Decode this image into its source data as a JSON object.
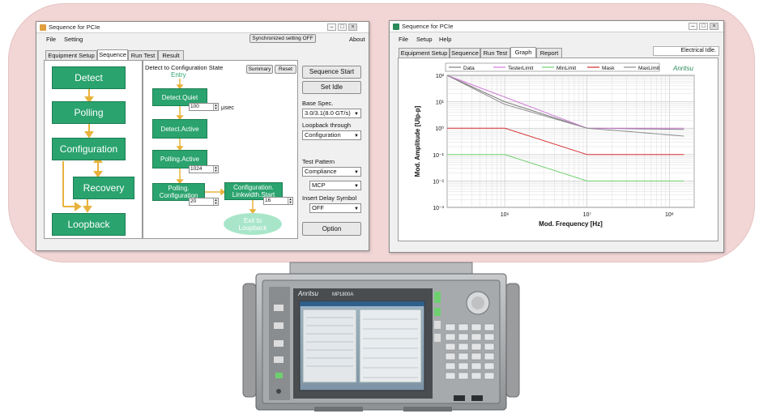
{
  "left_window": {
    "title": "Sequence for PCIe",
    "menu": [
      "File",
      "Setting"
    ],
    "sync_button": "Synchronized setting OFF",
    "about": "About",
    "tabs": [
      "Equipment Setup",
      "Sequence",
      "Run Test",
      "Result"
    ],
    "active_tab": "Sequence",
    "flow": [
      "Detect",
      "Polling",
      "Configuration",
      "Recovery",
      "Loopback"
    ],
    "detail_title": "Detect to Configuration State",
    "entry_label": "Entry",
    "summary_button": "Summary",
    "reset_button": "Reset",
    "states": {
      "detect_quiet": "Detect.Quiet",
      "detect_active": "Detect.Active",
      "polling_active": "Polling.Active",
      "polling_config": "Polling. Configuration",
      "config_linkwidth": "Configuration. Linkwidth.Start",
      "exit": "Exit to Loopback"
    },
    "quiet_value": "100",
    "quiet_unit": "µsec",
    "polling_active_value": "1024",
    "polling_config_value": "20",
    "config_linkwidth_value": "16",
    "sequence_start": "Sequence Start",
    "set_idle": "Set Idle",
    "base_spec_label": "Base Spec.",
    "base_spec_value": "3.0/3.1(8.0 GT/s)",
    "loopback_label": "Loopback through",
    "loopback_value": "Configuration",
    "test_pattern_label": "Test Pattern",
    "test_pattern_value": "Compliance",
    "mcp_value": "MCP",
    "insert_delay_label": "Insert Delay Symbol",
    "insert_delay_value": "OFF",
    "option_button": "Option"
  },
  "right_window": {
    "title": "Sequence for PCIe",
    "menu": [
      "File",
      "Setup",
      "Help"
    ],
    "tabs": [
      "Equipment Setup",
      "Sequence",
      "Run Test",
      "Graph",
      "Report"
    ],
    "active_tab": "Graph",
    "status_text": "Electrical Idle.",
    "brand": "Anritsu"
  },
  "instrument": {
    "brand": "Anritsu",
    "model": "MP1800A"
  },
  "colors": {
    "state_green": "#2aa36e",
    "exit_green": "#a9e6c9",
    "arrow": "#e8b23c",
    "pink_frame": "#f2d6d6",
    "tester_limit": "#d07bd8",
    "mask": "#d42a2a",
    "min_limit": "#6fd26f",
    "data": "#7f7f7f",
    "max_limit": "#8d8d8d"
  },
  "chart_data": {
    "type": "line",
    "xlabel": "Mod. Frequency [Hz]",
    "ylabel": "Mod. Amplitude [UIp-p]",
    "x_scale": "log",
    "y_scale": "log",
    "xlim": [
      200000,
      200000000
    ],
    "ylim": [
      0.001,
      100
    ],
    "x_ticks": [
      1000000,
      10000000,
      100000000
    ],
    "x_tick_labels": [
      "10⁶",
      "10⁷",
      "10⁸"
    ],
    "y_ticks": [
      0.001,
      0.01,
      0.1,
      1,
      10,
      100
    ],
    "y_tick_labels": [
      "10⁻³",
      "10⁻²",
      "10⁻¹",
      "10⁰",
      "10¹",
      "10²"
    ],
    "grid": true,
    "legend": "top",
    "series": [
      {
        "name": "Data",
        "color": "#7f7f7f",
        "x": [
          200000,
          1000000,
          10000000,
          150000000
        ],
        "y": [
          100,
          10,
          1,
          0.9
        ]
      },
      {
        "name": "TesterLimit",
        "color": "#d07bd8",
        "x": [
          200000,
          10000000,
          150000000
        ],
        "y": [
          100,
          1,
          1
        ]
      },
      {
        "name": "MinLimit",
        "color": "#6fd26f",
        "x": [
          200000,
          1000000,
          10000000,
          150000000
        ],
        "y": [
          0.1,
          0.1,
          0.01,
          0.01
        ]
      },
      {
        "name": "Mask",
        "color": "#d42a2a",
        "x": [
          200000,
          1000000,
          10000000,
          150000000
        ],
        "y": [
          1,
          1,
          0.1,
          0.1
        ]
      },
      {
        "name": "MaxLimit",
        "color": "#8d8d8d",
        "x": [
          200000,
          1000000,
          10000000,
          150000000
        ],
        "y": [
          100,
          8,
          1,
          0.5
        ]
      }
    ]
  }
}
